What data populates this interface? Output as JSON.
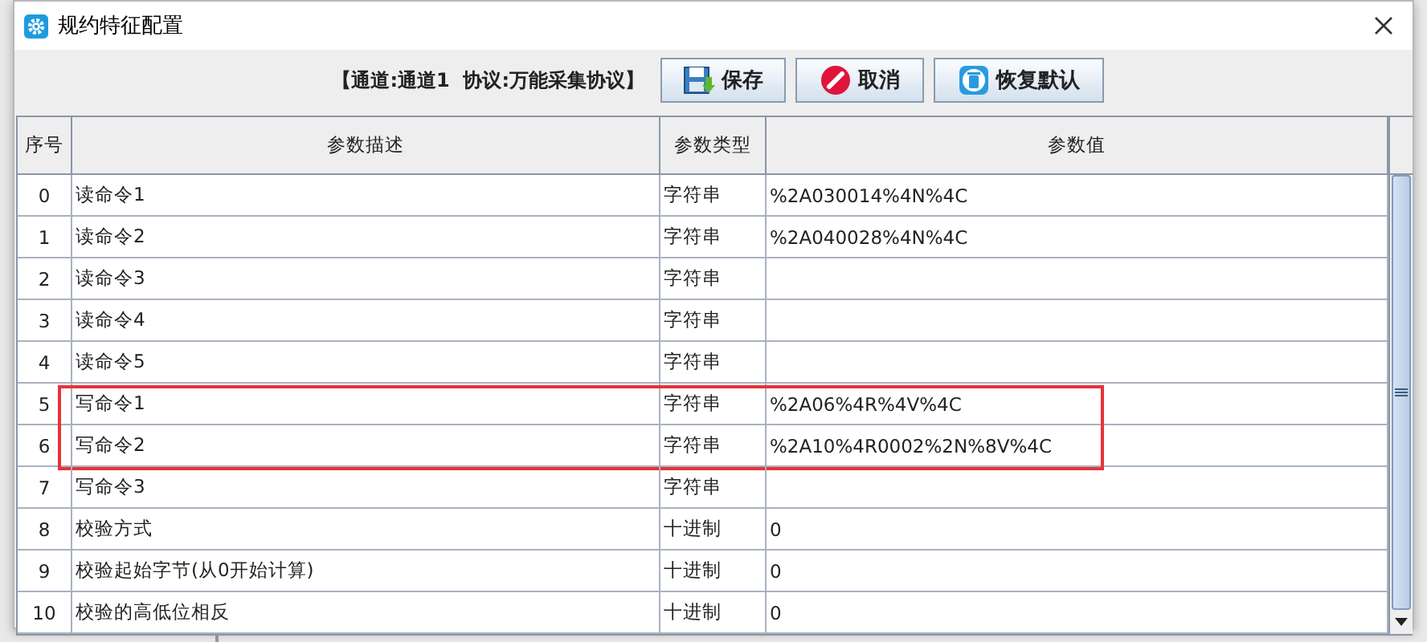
{
  "window": {
    "title": "规约特征配置"
  },
  "toolbar": {
    "info": "【通道:通道1  协议:万能采集协议】",
    "buttons": [
      {
        "kind": "save",
        "label": "保存"
      },
      {
        "kind": "cancel",
        "label": "取消"
      },
      {
        "kind": "restore",
        "label": "恢复默认"
      }
    ]
  },
  "table": {
    "columns": [
      "序号",
      "参数描述",
      "参数类型",
      "参数值"
    ],
    "rows": [
      {
        "index": "0",
        "description": "读命令1",
        "type": "字符串",
        "value": "%2A030014%4N%4C",
        "marked": false
      },
      {
        "index": "1",
        "description": "读命令2",
        "type": "字符串",
        "value": "%2A040028%4N%4C",
        "marked": false
      },
      {
        "index": "2",
        "description": "读命令3",
        "type": "字符串",
        "value": "",
        "marked": false
      },
      {
        "index": "3",
        "description": "读命令4",
        "type": "字符串",
        "value": "",
        "marked": false
      },
      {
        "index": "4",
        "description": "读命令5",
        "type": "字符串",
        "value": "",
        "marked": false
      },
      {
        "index": "5",
        "description": "写命令1",
        "type": "字符串",
        "value": "%2A06%4R%4V%4C",
        "marked": true
      },
      {
        "index": "6",
        "description": "写命令2",
        "type": "字符串",
        "value": "%2A10%4R0002%2N%8V%4C",
        "marked": true
      },
      {
        "index": "7",
        "description": "写命令3",
        "type": "字符串",
        "value": "",
        "marked": false
      },
      {
        "index": "8",
        "description": "校验方式",
        "type": "十进制",
        "value": "0",
        "marked": false
      },
      {
        "index": "9",
        "description": "校验起始字节(从0开始计算)",
        "type": "十进制",
        "value": "0",
        "marked": false
      },
      {
        "index": "10",
        "description": "校验的高低位相反",
        "type": "十进制",
        "value": "0",
        "marked": false
      }
    ]
  }
}
